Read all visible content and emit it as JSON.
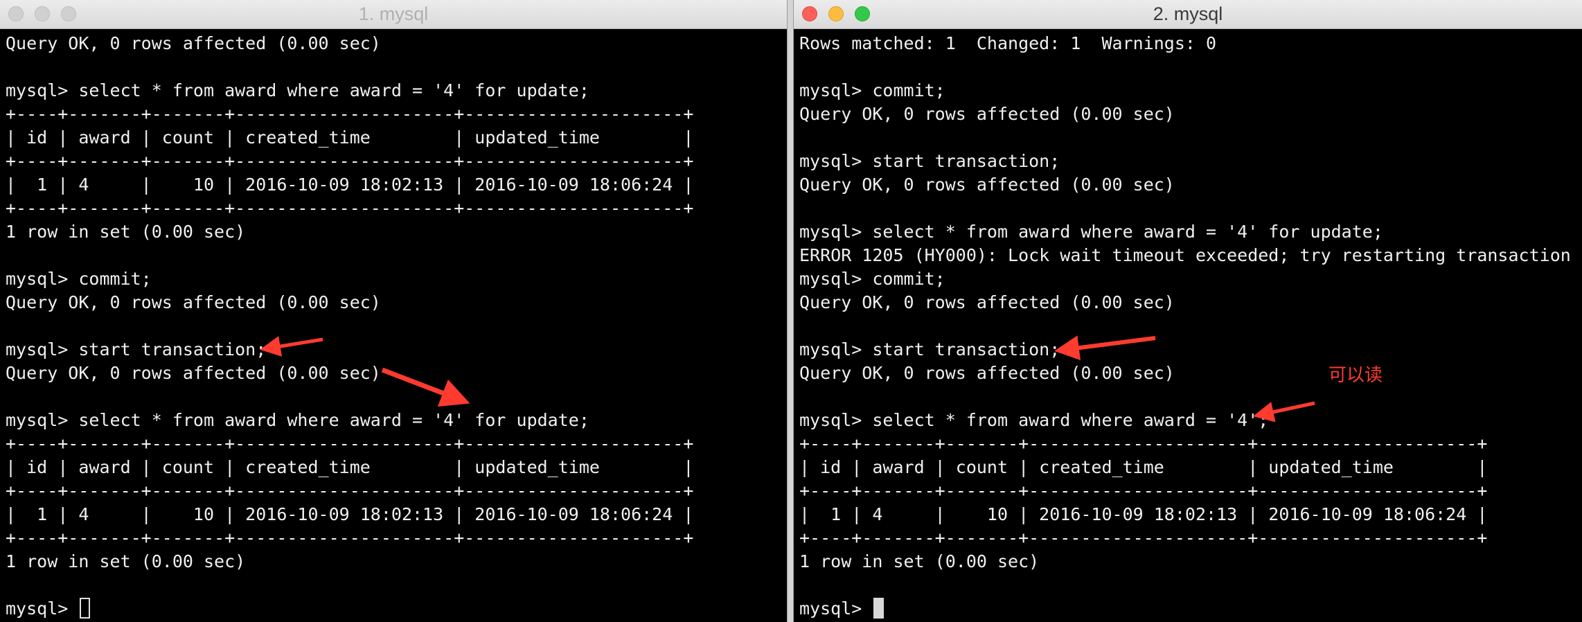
{
  "window1": {
    "title": "1. mysql",
    "lines": [
      "Query OK, 0 rows affected (0.00 sec)",
      "",
      "mysql> select * from award where award = '4' for update;",
      "+----+-------+-------+---------------------+---------------------+",
      "| id | award | count | created_time        | updated_time        |",
      "+----+-------+-------+---------------------+---------------------+",
      "|  1 | 4     |    10 | 2016-10-09 18:02:13 | 2016-10-09 18:06:24 |",
      "+----+-------+-------+---------------------+---------------------+",
      "1 row in set (0.00 sec)",
      "",
      "mysql> commit;",
      "Query OK, 0 rows affected (0.00 sec)",
      "",
      "mysql> start transaction;",
      "Query OK, 0 rows affected (0.00 sec)",
      "",
      "mysql> select * from award where award = '4' for update;",
      "+----+-------+-------+---------------------+---------------------+",
      "| id | award | count | created_time        | updated_time        |",
      "+----+-------+-------+---------------------+---------------------+",
      "|  1 | 4     |    10 | 2016-10-09 18:02:13 | 2016-10-09 18:06:24 |",
      "+----+-------+-------+---------------------+---------------------+",
      "1 row in set (0.00 sec)",
      ""
    ],
    "prompt": "mysql> "
  },
  "window2": {
    "title": "2. mysql",
    "lines": [
      "Rows matched: 1  Changed: 1  Warnings: 0",
      "",
      "mysql> commit;",
      "Query OK, 0 rows affected (0.00 sec)",
      "",
      "mysql> start transaction;",
      "Query OK, 0 rows affected (0.00 sec)",
      "",
      "mysql> select * from award where award = '4' for update;",
      "ERROR 1205 (HY000): Lock wait timeout exceeded; try restarting transaction",
      "mysql> commit;",
      "Query OK, 0 rows affected (0.00 sec)",
      "",
      "mysql> start transaction;",
      "Query OK, 0 rows affected (0.00 sec)",
      "",
      "mysql> select * from award where award = '4';",
      "+----+-------+-------+---------------------+---------------------+",
      "| id | award | count | created_time        | updated_time        |",
      "+----+-------+-------+---------------------+---------------------+",
      "|  1 | 4     |    10 | 2016-10-09 18:02:13 | 2016-10-09 18:06:24 |",
      "+----+-------+-------+---------------------+---------------------+",
      "1 row in set (0.00 sec)",
      ""
    ],
    "prompt": "mysql> "
  },
  "annotation": {
    "text": "可以读",
    "color": "#ff3b30"
  },
  "colors": {
    "terminal_bg": "#000000",
    "terminal_fg": "#f0f0f0",
    "arrow": "#ff3b30"
  }
}
